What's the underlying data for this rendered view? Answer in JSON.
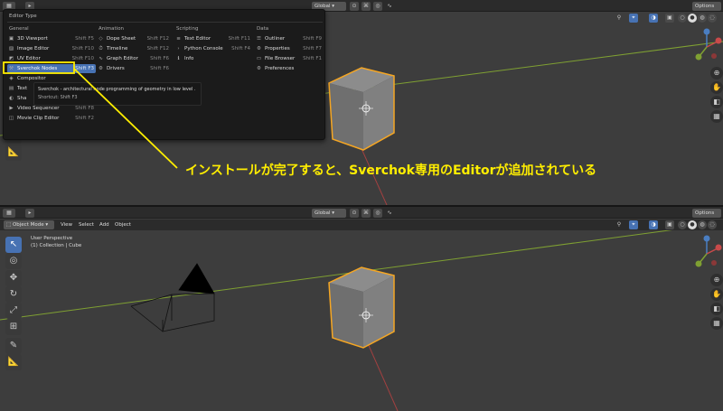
{
  "top": {
    "options_label": "Options",
    "header": {
      "transform": "Global"
    },
    "menu": {
      "title": "Editor Type",
      "categories": [
        {
          "name": "General",
          "items": [
            {
              "label": "3D Viewport",
              "shortcut": "Shift F5",
              "icon": "cube-icon"
            },
            {
              "label": "Image Editor",
              "shortcut": "Shift F10",
              "icon": "image-icon"
            },
            {
              "label": "UV Editor",
              "shortcut": "Shift F10",
              "icon": "uv-icon"
            },
            {
              "label": "Sverchok Nodes",
              "shortcut": "Shift F3",
              "icon": "sverchok-icon"
            },
            {
              "label": "Compositor",
              "shortcut": "",
              "icon": "compositor-icon"
            },
            {
              "label": "Text",
              "shortcut": "",
              "icon": "texture-icon"
            },
            {
              "label": "Sha",
              "shortcut": "",
              "icon": "shader-icon"
            },
            {
              "label": "Video Sequencer",
              "shortcut": "Shift F8",
              "icon": "video-icon"
            },
            {
              "label": "Movie Clip Editor",
              "shortcut": "Shift F2",
              "icon": "clip-icon"
            }
          ]
        },
        {
          "name": "Animation",
          "items": [
            {
              "label": "Dope Sheet",
              "shortcut": "Shift F12",
              "icon": "dopesheet-icon"
            },
            {
              "label": "Timeline",
              "shortcut": "Shift F12",
              "icon": "timeline-icon"
            },
            {
              "label": "Graph Editor",
              "shortcut": "Shift F6",
              "icon": "graph-icon"
            },
            {
              "label": "Drivers",
              "shortcut": "Shift F6",
              "icon": "drivers-icon"
            }
          ]
        },
        {
          "name": "Scripting",
          "items": [
            {
              "label": "Text Editor",
              "shortcut": "Shift F11",
              "icon": "text-editor-icon"
            },
            {
              "label": "Python Console",
              "shortcut": "Shift F4",
              "icon": "console-icon"
            },
            {
              "label": "Info",
              "shortcut": "",
              "icon": "info-icon"
            }
          ]
        },
        {
          "name": "Data",
          "items": [
            {
              "label": "Outliner",
              "shortcut": "Shift F9",
              "icon": "outliner-icon"
            },
            {
              "label": "Properties",
              "shortcut": "Shift F7",
              "icon": "properties-icon"
            },
            {
              "label": "File Browser",
              "shortcut": "Shift F1",
              "icon": "file-browser-icon"
            },
            {
              "label": "Preferences",
              "shortcut": "",
              "icon": "preferences-icon"
            }
          ]
        }
      ],
      "tooltip": {
        "line1": "Sverchok - architectural node programming of geometry in low level .",
        "line2": "Shortcut: Shift F3"
      }
    },
    "annotation": "インストールが完了すると、Sverchok専用のEditorが追加されている",
    "annotation_color": "#ffee00"
  },
  "bottom": {
    "options_label": "Options",
    "header": {
      "mode": "Object Mode",
      "menus": [
        "View",
        "Select",
        "Add",
        "Object"
      ],
      "transform": "Global"
    },
    "viewport": {
      "perspective": "User Perspective",
      "collection": "(1) Collection | Cube"
    }
  },
  "colors": {
    "accent": "#4772b3",
    "selection_outline": "#f5a623",
    "axis_x": "#c94a4a",
    "axis_y": "#7fa032"
  }
}
